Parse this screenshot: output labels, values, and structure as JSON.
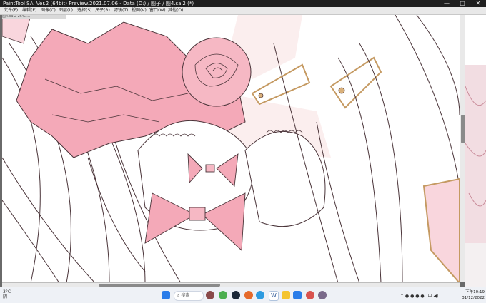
{
  "window": {
    "title": "PaintTool SAI Ver.2 (64bit) Preview.2021.07.06 - Data (D:) / 图子 / 图4.sai2 (*)",
    "minimize_icon": "minimize-icon",
    "maximize_icon": "maximize-icon",
    "close_icon": "close-icon"
  },
  "menu": {
    "items": [
      "文件(F)",
      "编辑(E)",
      "图像(C)",
      "图层(L)",
      "选择(S)",
      "尺子(R)",
      "滤镜(T)",
      "视图(V)",
      "窗口(W)",
      "其他(O)"
    ]
  },
  "canvas": {
    "tab_label": "图4.sai2  25% ...",
    "colors": {
      "line": "#3a2a2e",
      "pink": "#f4a9b8",
      "pink_light": "#f9d6dd",
      "gold": "#d9b07a",
      "bg": "#ffffff"
    }
  },
  "taskbar": {
    "weather_temp": "3°C",
    "weather_text": "阴",
    "search_label": "搜索",
    "clock_time": "下午10:19",
    "clock_date": "31/12/2022",
    "lang": "中",
    "icons": [
      "windows-start-icon",
      "search-icon",
      "avatar-icon",
      "chrome-icon",
      "steam-icon",
      "clash-icon",
      "edge-icon",
      "word-icon",
      "explorer-icon",
      "store-icon",
      "app-icon",
      "paint-icon"
    ]
  }
}
